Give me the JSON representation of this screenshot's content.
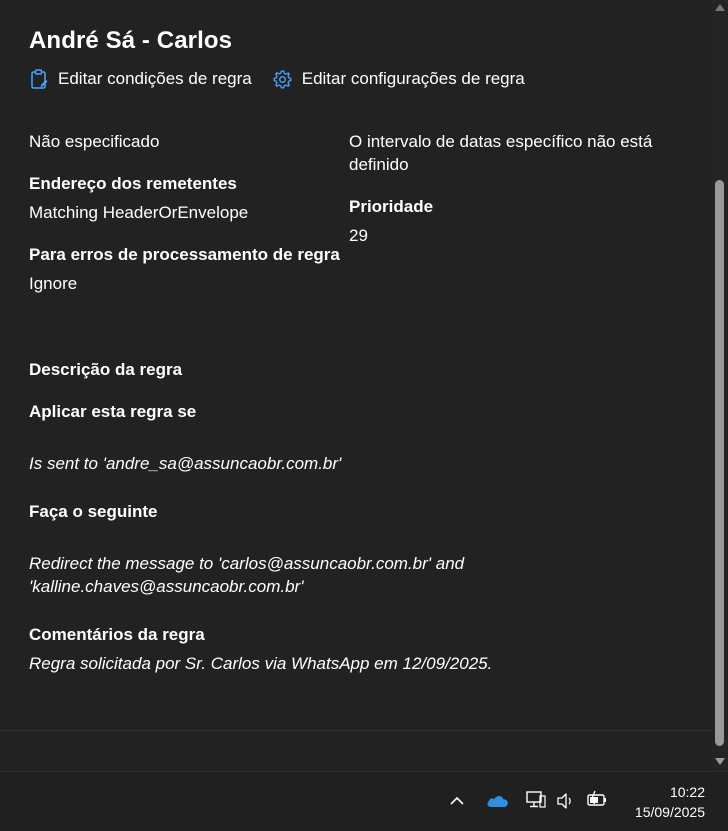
{
  "header": {
    "title": "André Sá - Carlos",
    "edit_conditions_label": "Editar condições de regra",
    "edit_settings_label": "Editar configurações de regra"
  },
  "details": {
    "left_status": "Não especificado",
    "sender_address_label": "Endereço dos remetentes",
    "sender_address_value": "Matching HeaderOrEnvelope",
    "error_label": "Para erros de processamento de regra",
    "error_value": "Ignore",
    "date_range_line1": "O intervalo de datas específico não está",
    "date_range_line2": "definido",
    "priority_label": "Prioridade",
    "priority_value": "29"
  },
  "description": {
    "heading": "Descrição da regra",
    "apply_label": "Aplicar esta regra se",
    "condition": "Is sent to 'andre_sa@assuncaobr.com.br'",
    "do_label": "Faça o seguinte",
    "action_line1": "Redirect the message to 'carlos@assuncaobr.com.br' and",
    "action_line2": "'kalline.chaves@assuncaobr.com.br'",
    "comments_label": "Comentários da regra",
    "comments_value": "Regra solicitada por Sr. Carlos via WhatsApp em 12/09/2025."
  },
  "taskbar": {
    "time": "10:22",
    "date": "15/09/2025",
    "icons": [
      "chevron-up-icon",
      "onedrive-cloud-icon",
      "network-icon",
      "volume-icon",
      "battery-icon"
    ]
  },
  "colors": {
    "background": "#222222",
    "accent": "#4aa3ff",
    "onedrive": "#2f8fe0"
  }
}
